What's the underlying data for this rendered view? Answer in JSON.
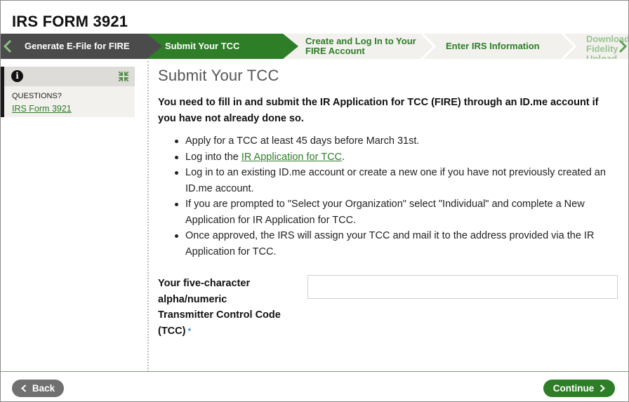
{
  "app": {
    "title": "IRS FORM 3921"
  },
  "stepper": {
    "steps": [
      {
        "label": "Generate E-File for FIRE",
        "state": "completed"
      },
      {
        "label": "Submit Your TCC",
        "state": "current"
      },
      {
        "label": "Create and Log In to Your FIRE Account",
        "state": "upcoming"
      },
      {
        "label": "Enter IRS Information",
        "state": "upcoming"
      },
      {
        "label": "Download Fidelity Upload",
        "state": "upcoming"
      }
    ],
    "prev_icon": "chevron-left-icon",
    "next_icon": "chevron-right-icon"
  },
  "sidebar": {
    "info_icon": "i",
    "collapse_icon": "collapse-arrows-icon",
    "questions_label": "QUESTIONS?",
    "link_label": "IRS Form 3921"
  },
  "main": {
    "title": "Submit Your TCC",
    "lead": "You need to fill in and submit the IR Application for TCC (FIRE) through an ID.me account if you have not already done so.",
    "bullets": [
      {
        "text": "Apply for a TCC at least 45 days before March 31st."
      },
      {
        "before": "Log into the ",
        "link": "IR Application for TCC",
        "after": "."
      },
      {
        "text": "Log in to an existing ID.me account or create a new one if you have not previously created an ID.me account."
      },
      {
        "text": "If you are prompted to \"Select your Organization\" select \"Individual\" and complete a New Application for IR Application for TCC."
      },
      {
        "text": "Once approved, the IRS will assign your TCC and mail it to the address provided via the IR Application for TCC."
      }
    ],
    "field": {
      "label": "Your five-character alpha/numeric Transmitter Control Code (TCC)",
      "required_mark": "*",
      "value": "",
      "placeholder": ""
    }
  },
  "footer": {
    "back_label": "Back",
    "continue_label": "Continue"
  },
  "colors": {
    "brand_green": "#2e7d27",
    "completed_step": "#4b4b4b",
    "stepper_bg": "#f2f1ee",
    "back_button": "#707070"
  }
}
